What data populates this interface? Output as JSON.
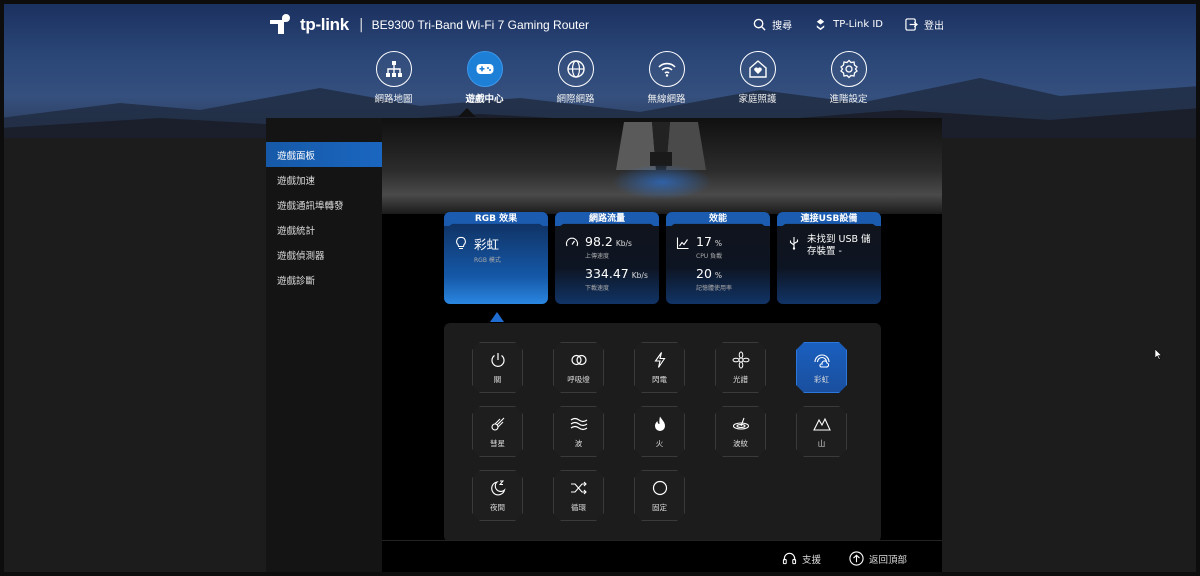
{
  "header": {
    "brand": "tp-link",
    "separator": "|",
    "model": "BE9300 Tri-Band Wi-Fi 7 Gaming Router",
    "actions": [
      {
        "label": "搜尋",
        "icon": "search-icon"
      },
      {
        "label": "TP-Link ID",
        "icon": "user-id-icon"
      },
      {
        "label": "登出",
        "icon": "logout-icon"
      }
    ]
  },
  "main_nav": [
    {
      "label": "網路地圖",
      "icon": "network-map-icon",
      "active": false
    },
    {
      "label": "遊戲中心",
      "icon": "gamepad-icon",
      "active": true
    },
    {
      "label": "網際網路",
      "icon": "globe-icon",
      "active": false
    },
    {
      "label": "無線網路",
      "icon": "wifi-icon",
      "active": false
    },
    {
      "label": "家庭照護",
      "icon": "home-care-icon",
      "active": false
    },
    {
      "label": "進階設定",
      "icon": "gear-icon",
      "active": false
    }
  ],
  "sidebar": {
    "items": [
      {
        "label": "遊戲面板",
        "active": true
      },
      {
        "label": "遊戲加速",
        "active": false
      },
      {
        "label": "遊戲通訊埠轉發",
        "active": false
      },
      {
        "label": "遊戲統計",
        "active": false
      },
      {
        "label": "遊戲偵測器",
        "active": false
      },
      {
        "label": "遊戲診斷",
        "active": false
      }
    ]
  },
  "cards": {
    "rgb": {
      "title": "RGB 效果",
      "value": "彩虹",
      "sub": "RGB 模式"
    },
    "traffic": {
      "title": "網路流量",
      "upload_value": "98.2",
      "upload_unit": "Kb/s",
      "upload_label": "上傳速度",
      "download_value": "334.47",
      "download_unit": "Kb/s",
      "download_label": "下載速度"
    },
    "performance": {
      "title": "效能",
      "cpu_value": "17",
      "cpu_unit": "%",
      "cpu_label": "CPU 負載",
      "mem_value": "20",
      "mem_unit": "%",
      "mem_label": "記憶體使用率"
    },
    "usb": {
      "title": "連接USB設備",
      "message": "未找到 USB 儲存裝置 -"
    }
  },
  "effects": [
    {
      "label": "關",
      "icon": "power-icon",
      "active": false
    },
    {
      "label": "呼吸燈",
      "icon": "breathing-icon",
      "active": false
    },
    {
      "label": "閃電",
      "icon": "lightning-icon",
      "active": false
    },
    {
      "label": "光譜",
      "icon": "spectrum-icon",
      "active": false
    },
    {
      "label": "彩虹",
      "icon": "rainbow-icon",
      "active": true
    },
    {
      "label": "彗星",
      "icon": "comet-icon",
      "active": false
    },
    {
      "label": "波",
      "icon": "wave-icon",
      "active": false
    },
    {
      "label": "火",
      "icon": "fire-icon",
      "active": false
    },
    {
      "label": "波紋",
      "icon": "ripple-icon",
      "active": false
    },
    {
      "label": "山",
      "icon": "mountain-icon",
      "active": false
    },
    {
      "label": "夜間",
      "icon": "night-icon",
      "active": false
    },
    {
      "label": "循環",
      "icon": "shuffle-icon",
      "active": false
    },
    {
      "label": "固定",
      "icon": "circle-icon",
      "active": false
    }
  ],
  "footer": {
    "support": "支援",
    "back_to_top": "返回頂部"
  },
  "colors": {
    "accent": "#1e7fd7",
    "active_card": "#1558a8",
    "panel": "#1c1c1c"
  }
}
